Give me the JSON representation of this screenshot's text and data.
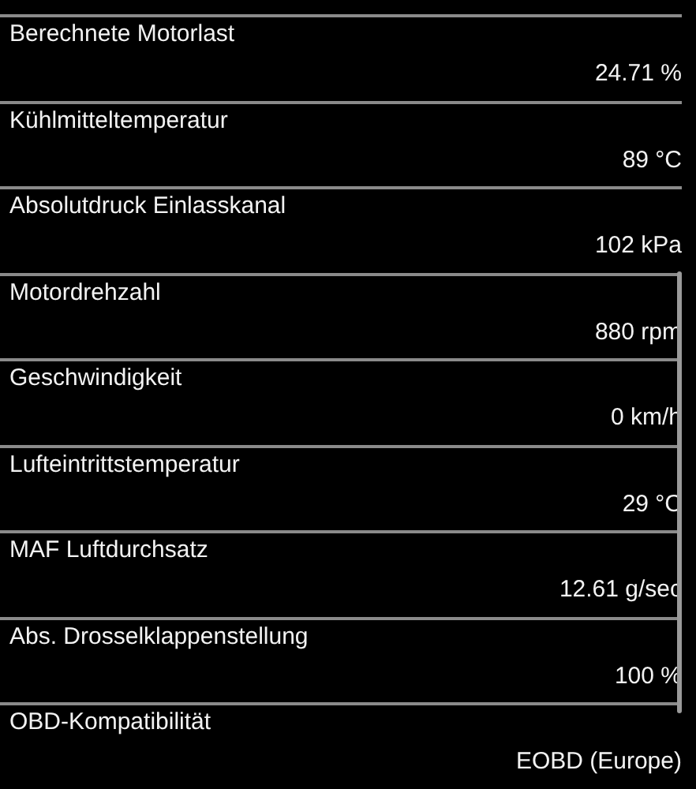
{
  "rows": [
    {
      "label": "Berechnete Motorlast",
      "value": "24.71 %"
    },
    {
      "label": "Kühlmitteltemperatur",
      "value": "89 °C"
    },
    {
      "label": "Absolutdruck Einlasskanal",
      "value": "102 kPa"
    },
    {
      "label": "Motordrehzahl",
      "value": "880 rpm"
    },
    {
      "label": "Geschwindigkeit",
      "value": "0 km/h"
    },
    {
      "label": "Lufteintrittstemperatur",
      "value": "29 °C"
    },
    {
      "label": "MAF Luftdurchsatz",
      "value": "12.61 g/sec"
    },
    {
      "label": "Abs. Drosselklappenstellung",
      "value": "100 %"
    },
    {
      "label": "OBD-Kompatibilität",
      "value": "EOBD (Europe)"
    }
  ]
}
